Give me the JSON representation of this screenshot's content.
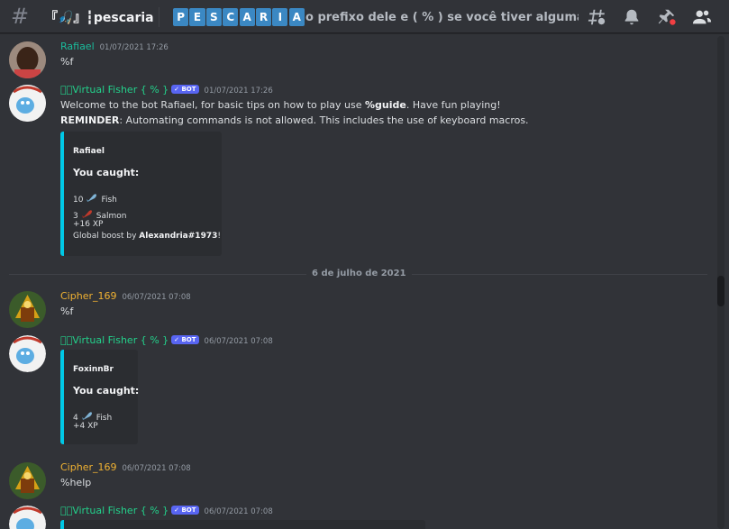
{
  "header": {
    "channel_name": "『🎣』┇pescaria",
    "topic_tiles": [
      "P",
      "E",
      "S",
      "C",
      "A",
      "R",
      "I",
      "A"
    ],
    "topic_text": "o prefixo dele e ( % ) se você tiver alguma dúvi..."
  },
  "messages": [
    {
      "author": "Rafiael",
      "timestamp": "01/07/2021 17:26",
      "text": "%f"
    },
    {
      "author": "⭑ৈVirtual Fisher { % }",
      "bot_tag": "✓ BOT",
      "timestamp": "01/07/2021 17:26",
      "line1_pre": "Welcome to the bot Rafiael, for basic tips on how to play use ",
      "line1_cmd": "%guide",
      "line1_post": ". Have fun playing!",
      "line2_bold": "REMINDER",
      "line2_rest": ": Automating commands is not allowed. This includes the use of keyboard macros.",
      "embed": {
        "author": "Rafiael",
        "title": "You caught:",
        "catch1": "10",
        "catch1_name": "Fish",
        "catch2": "3",
        "catch2_name": "Salmon",
        "xp": "+16 XP",
        "boost_pre": "Global boost by ",
        "boost_user": "Alexandria#1973",
        "boost_post": "!"
      }
    },
    {
      "author": "Cipher_169",
      "timestamp": "06/07/2021 07:08",
      "text": "%f"
    },
    {
      "author": "⭑ৈVirtual Fisher { % }",
      "bot_tag": "✓ BOT",
      "timestamp": "06/07/2021 07:08",
      "embed": {
        "author": "FoxinnBr",
        "title": "You caught:",
        "catch1": "4",
        "catch1_name": "Fish",
        "xp": "+4 XP"
      }
    },
    {
      "author": "Cipher_169",
      "timestamp": "06/07/2021 07:08",
      "text": "%help"
    },
    {
      "author": "⭑ৈVirtual Fisher { % }",
      "bot_tag": "✓ BOT",
      "timestamp": "06/07/2021 07:08"
    }
  ],
  "date_separator": "6 de julho de 2021",
  "colors": {
    "bot_name": "#23d18b",
    "cipher_name": "#f0b232",
    "rafiael_name": "#1abc9c",
    "embed_bar": "#00c8e6",
    "badge": "#5865f2"
  },
  "icons": [
    "threads-icon",
    "bell-icon",
    "pin-icon",
    "members-icon"
  ]
}
